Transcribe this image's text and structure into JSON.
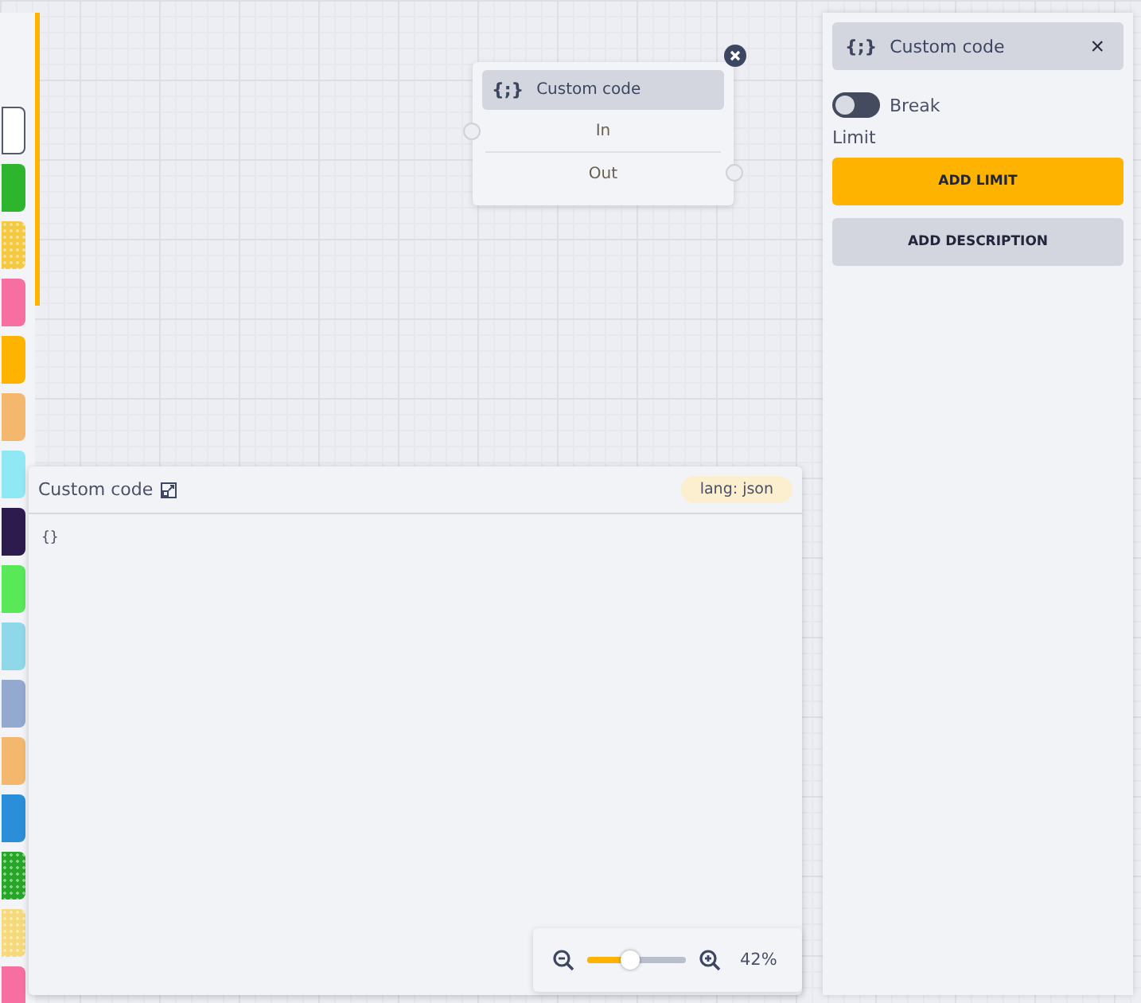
{
  "palette": {
    "swatches": [
      {
        "color": "#ffffff",
        "kind": "outline"
      },
      {
        "color": "#2db52d",
        "kind": "solid"
      },
      {
        "color": "#f5c842",
        "kind": "dotted"
      },
      {
        "color": "#f76fa0",
        "kind": "solid"
      },
      {
        "color": "#fdb300",
        "kind": "solid"
      },
      {
        "color": "#f3b86e",
        "kind": "solid"
      },
      {
        "color": "#90e8f5",
        "kind": "solid"
      },
      {
        "color": "#2d1b4e",
        "kind": "solid"
      },
      {
        "color": "#58e858",
        "kind": "solid"
      },
      {
        "color": "#8ed8ea",
        "kind": "solid"
      },
      {
        "color": "#94a9cf",
        "kind": "solid"
      },
      {
        "color": "#f3b86e",
        "kind": "solid"
      },
      {
        "color": "#2a8fd8",
        "kind": "solid"
      },
      {
        "color": "#27a727",
        "kind": "dotted"
      },
      {
        "color": "#f5d97a",
        "kind": "dotted"
      },
      {
        "color": "#f76fa0",
        "kind": "solid"
      }
    ]
  },
  "node": {
    "icon": "{;}",
    "title": "Custom code",
    "input": "In",
    "output": "Out"
  },
  "editor": {
    "title": "Custom code",
    "badge": "lang: json",
    "code": "{}"
  },
  "zoom": {
    "level": 0.44,
    "reading": "42%"
  },
  "inspector": {
    "icon": "{;}",
    "title": "Custom code",
    "close": "×",
    "toggle": {
      "label": "Break",
      "on": false
    },
    "limit_label": "Limit",
    "buttons": [
      {
        "label": "ADD LIMIT",
        "kind": "primary"
      },
      {
        "label": "ADD DESCRIPTION",
        "kind": "secondary"
      }
    ]
  }
}
